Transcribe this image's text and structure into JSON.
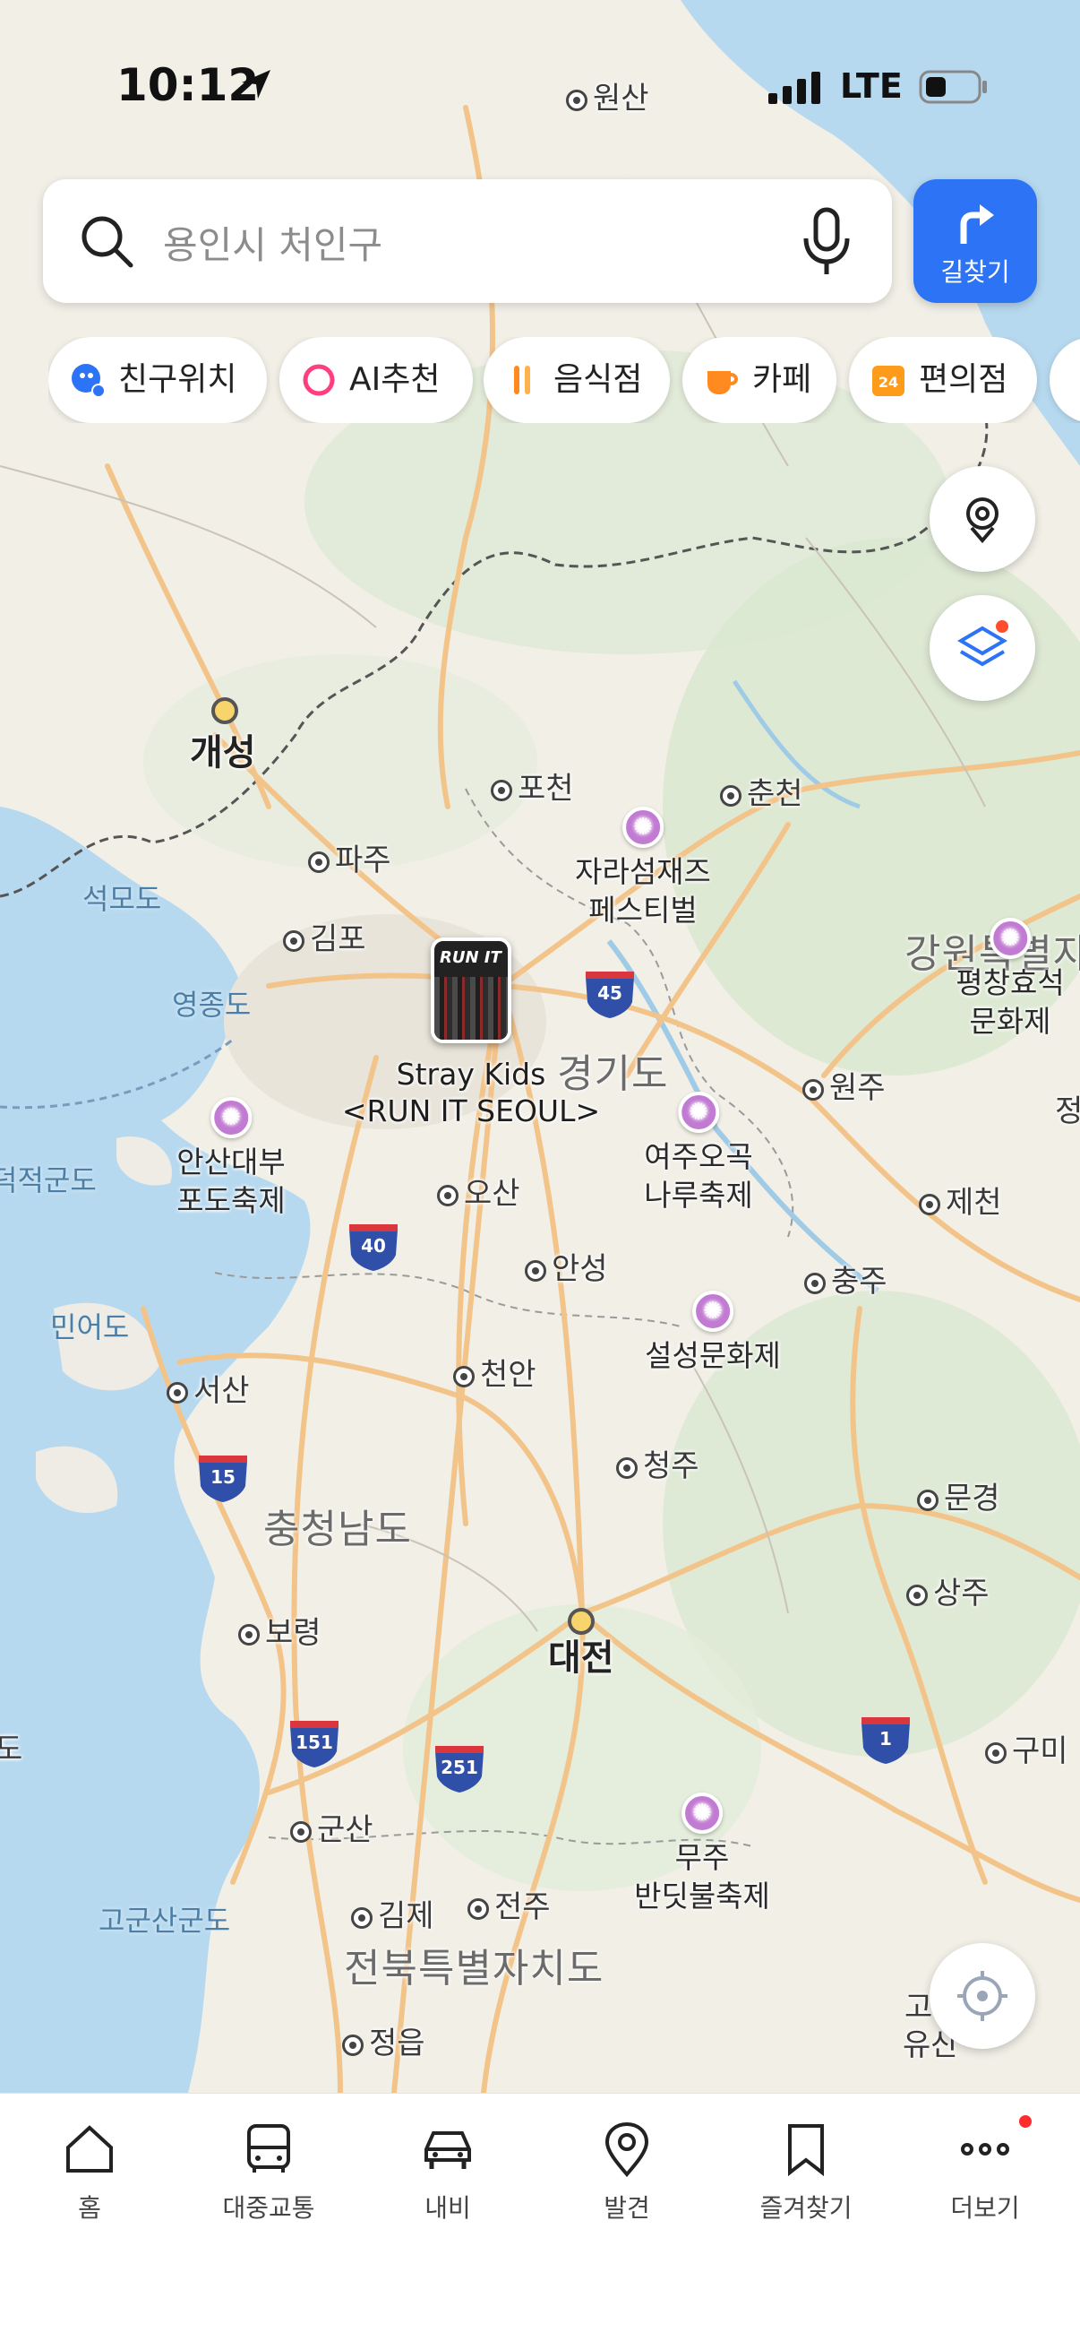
{
  "status_bar": {
    "time": "10:12",
    "network": "LTE"
  },
  "search": {
    "placeholder": "용인시 처인구"
  },
  "route_button": {
    "label": "길찾기"
  },
  "chips": [
    {
      "label": "친구위치",
      "icon": "friend-location-icon",
      "color": "#2d73f5"
    },
    {
      "label": "AI추천",
      "icon": "ai-ring-icon",
      "color": "#ff3e7f"
    },
    {
      "label": "음식점",
      "icon": "restaurant-icon",
      "color": "#ff8a1f"
    },
    {
      "label": "카페",
      "icon": "coffee-cup-icon",
      "color": "#ff8a1f"
    },
    {
      "label": "편의점",
      "icon": "convenience-store-icon",
      "color": "#ff9b1a"
    }
  ],
  "map": {
    "cities": [
      {
        "name": "원산"
      },
      {
        "name": "개성"
      },
      {
        "name": "포천"
      },
      {
        "name": "춘천"
      },
      {
        "name": "파주"
      },
      {
        "name": "김포"
      },
      {
        "name": "원주"
      },
      {
        "name": "오산"
      },
      {
        "name": "제천"
      },
      {
        "name": "안성"
      },
      {
        "name": "충주"
      },
      {
        "name": "천안"
      },
      {
        "name": "서산"
      },
      {
        "name": "청주"
      },
      {
        "name": "문경"
      },
      {
        "name": "상주"
      },
      {
        "name": "보령"
      },
      {
        "name": "대전"
      },
      {
        "name": "구미"
      },
      {
        "name": "군산"
      },
      {
        "name": "김제"
      },
      {
        "name": "전주"
      },
      {
        "name": "정읍"
      }
    ],
    "regions": [
      "경기도",
      "충청남도",
      "전북특별자치도",
      "강원특별자"
    ],
    "water_labels": [
      "석모도",
      "영종도",
      "민어도",
      "고군산군도",
      "덕적군도"
    ],
    "festivals": [
      {
        "line1": "자라섬재즈",
        "line2": "페스티벌"
      },
      {
        "line1": "평창효석",
        "line2": "문화제"
      },
      {
        "line1": "안산대부",
        "line2": "포도축제"
      },
      {
        "line1": "여주오곡",
        "line2": "나루축제"
      },
      {
        "line1": "설성문화제",
        "line2": ""
      },
      {
        "line1": "무주",
        "line2": "반딧불축제"
      }
    ],
    "concert": {
      "line1": "Stray Kids",
      "line2": "<RUN IT SEOUL>",
      "art_title": "RUN IT"
    },
    "highway_shields": [
      "45",
      "40",
      "15",
      "151",
      "251",
      "1"
    ],
    "partial_labels": [
      "고",
      "유산",
      "정",
      "도"
    ]
  },
  "bottom_nav": [
    {
      "label": "홈",
      "icon": "home-icon"
    },
    {
      "label": "대중교통",
      "icon": "bus-icon"
    },
    {
      "label": "내비",
      "icon": "car-icon"
    },
    {
      "label": "발견",
      "icon": "location-pin-icon"
    },
    {
      "label": "즐겨찾기",
      "icon": "bookmark-icon"
    },
    {
      "label": "더보기",
      "icon": "more-dots-icon"
    }
  ]
}
